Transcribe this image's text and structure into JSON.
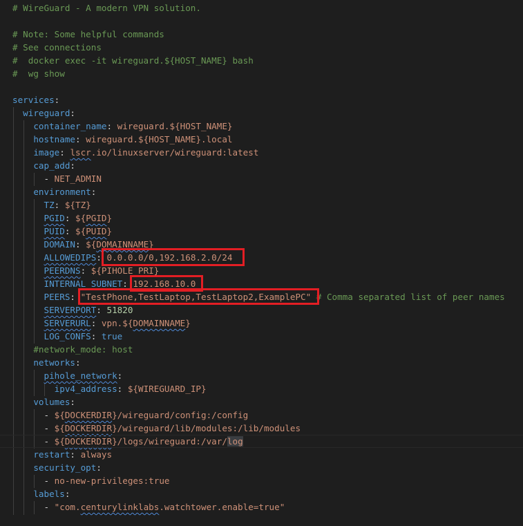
{
  "editor": {
    "language": "yaml",
    "highlight_color": "#e31e24",
    "lines": [
      {
        "tokens": [
          [
            "cm",
            "# WireGuard - A modern VPN solution."
          ]
        ]
      },
      {
        "tokens": []
      },
      {
        "tokens": [
          [
            "cm",
            "# Note: Some helpful commands"
          ]
        ]
      },
      {
        "tokens": [
          [
            "cm",
            "# See connections"
          ]
        ]
      },
      {
        "tokens": [
          [
            "cm",
            "#  docker exec -it wireguard.${HOST_NAME} bash"
          ]
        ]
      },
      {
        "tokens": [
          [
            "cm",
            "#  wg show"
          ]
        ]
      },
      {
        "tokens": []
      },
      {
        "tokens": [
          [
            "k",
            "services"
          ],
          [
            "p",
            ":"
          ]
        ]
      },
      {
        "tokens": [
          [
            "p",
            "  "
          ],
          [
            "k",
            "wireguard"
          ],
          [
            "p",
            ":"
          ]
        ]
      },
      {
        "tokens": [
          [
            "p",
            "    "
          ],
          [
            "k",
            "container_name"
          ],
          [
            "p",
            ": "
          ],
          [
            "s",
            "wireguard.${HOST_NAME}"
          ]
        ]
      },
      {
        "tokens": [
          [
            "p",
            "    "
          ],
          [
            "k",
            "hostname"
          ],
          [
            "p",
            ": "
          ],
          [
            "s",
            "wireguard.${HOST_NAME}.local"
          ]
        ]
      },
      {
        "tokens": [
          [
            "p",
            "    "
          ],
          [
            "k",
            "image"
          ],
          [
            "p",
            ": "
          ],
          [
            "s sq",
            "lscr"
          ],
          [
            "s",
            ".io/linuxserver/wireguard:latest"
          ]
        ]
      },
      {
        "tokens": [
          [
            "p",
            "    "
          ],
          [
            "k",
            "cap_add"
          ],
          [
            "p",
            ":"
          ]
        ]
      },
      {
        "tokens": [
          [
            "p",
            "      - "
          ],
          [
            "s",
            "NET_ADMIN"
          ]
        ]
      },
      {
        "tokens": [
          [
            "p",
            "    "
          ],
          [
            "k",
            "environment"
          ],
          [
            "p",
            ":"
          ]
        ]
      },
      {
        "tokens": [
          [
            "p",
            "      "
          ],
          [
            "k",
            "TZ"
          ],
          [
            "p",
            ": "
          ],
          [
            "s",
            "${TZ}"
          ]
        ]
      },
      {
        "tokens": [
          [
            "p",
            "      "
          ],
          [
            "k sq",
            "PGID"
          ],
          [
            "p",
            ": "
          ],
          [
            "s",
            "${"
          ],
          [
            "s sq",
            "PGID"
          ],
          [
            "s",
            "}"
          ]
        ]
      },
      {
        "tokens": [
          [
            "p",
            "      "
          ],
          [
            "k sq",
            "PUID"
          ],
          [
            "p",
            ": "
          ],
          [
            "s",
            "${"
          ],
          [
            "s sq",
            "PUID"
          ],
          [
            "s",
            "}"
          ]
        ]
      },
      {
        "tokens": [
          [
            "p",
            "      "
          ],
          [
            "k",
            "DOMAIN"
          ],
          [
            "p",
            ": "
          ],
          [
            "s",
            "${"
          ],
          [
            "s sq",
            "DOMAINNAME"
          ],
          [
            "s",
            "}"
          ]
        ]
      },
      {
        "tokens": [
          [
            "p",
            "      "
          ],
          [
            "k sq",
            "ALLOWEDIPS"
          ],
          [
            "p",
            ": "
          ],
          [
            "s",
            "0.0.0.0/0,192.168.2.0/24"
          ]
        ]
      },
      {
        "tokens": [
          [
            "p",
            "      "
          ],
          [
            "k sq",
            "PEERDNS"
          ],
          [
            "p",
            ": "
          ],
          [
            "s",
            "${PIHOLE_PRI}"
          ]
        ]
      },
      {
        "tokens": [
          [
            "p",
            "      "
          ],
          [
            "k",
            "INTERNAL_SUBNET"
          ],
          [
            "p",
            ": "
          ],
          [
            "s",
            "192.168.10.0"
          ]
        ]
      },
      {
        "tokens": [
          [
            "p",
            "      "
          ],
          [
            "k",
            "PEERS"
          ],
          [
            "p",
            ": "
          ],
          [
            "s",
            "\"TestPhone,TestLaptop,TestLaptop2,ExamplePC\""
          ],
          [
            "cm",
            " # Comma separated list of peer names"
          ]
        ]
      },
      {
        "tokens": [
          [
            "p",
            "      "
          ],
          [
            "k sq",
            "SERVERPORT"
          ],
          [
            "p",
            ": "
          ],
          [
            "n",
            "51820"
          ]
        ]
      },
      {
        "tokens": [
          [
            "p",
            "      "
          ],
          [
            "k sq",
            "SERVERURL"
          ],
          [
            "p",
            ": "
          ],
          [
            "s",
            "vpn.${"
          ],
          [
            "s sq",
            "DOMAINNAME"
          ],
          [
            "s",
            "}"
          ]
        ]
      },
      {
        "tokens": [
          [
            "p",
            "      "
          ],
          [
            "k",
            "LOG_CONFS"
          ],
          [
            "p",
            ": "
          ],
          [
            "k",
            "true"
          ]
        ]
      },
      {
        "tokens": [
          [
            "p",
            "    "
          ],
          [
            "cm",
            "#network_mode: host"
          ]
        ]
      },
      {
        "tokens": [
          [
            "p",
            "    "
          ],
          [
            "k",
            "networks"
          ],
          [
            "p",
            ":"
          ]
        ]
      },
      {
        "tokens": [
          [
            "p",
            "      "
          ],
          [
            "k sq",
            "pihole_network"
          ],
          [
            "p",
            ":"
          ]
        ]
      },
      {
        "tokens": [
          [
            "p",
            "        "
          ],
          [
            "k",
            "ipv4_address"
          ],
          [
            "p",
            ": "
          ],
          [
            "s",
            "${WIREGUARD_IP}"
          ]
        ]
      },
      {
        "tokens": [
          [
            "p",
            "    "
          ],
          [
            "k",
            "volumes"
          ],
          [
            "p",
            ":"
          ]
        ]
      },
      {
        "tokens": [
          [
            "p",
            "      - "
          ],
          [
            "s",
            "${"
          ],
          [
            "s sq",
            "DOCKERDIR"
          ],
          [
            "s",
            "}/wireguard/config:/config"
          ]
        ]
      },
      {
        "tokens": [
          [
            "p",
            "      - "
          ],
          [
            "s",
            "${"
          ],
          [
            "s sq",
            "DOCKERDIR"
          ],
          [
            "s",
            "}/wireguard/lib/modules:/lib/modules"
          ]
        ]
      },
      {
        "tokens": [
          [
            "p",
            "      - "
          ],
          [
            "s",
            "${"
          ],
          [
            "s sq",
            "DOCKERDIR"
          ],
          [
            "s",
            "}/logs/wireguard:/var/"
          ],
          [
            "s cursel",
            "log"
          ]
        ]
      },
      {
        "tokens": [
          [
            "p",
            "    "
          ],
          [
            "k",
            "restart"
          ],
          [
            "p",
            ": "
          ],
          [
            "s",
            "always"
          ]
        ]
      },
      {
        "tokens": [
          [
            "p",
            "    "
          ],
          [
            "k",
            "security_opt"
          ],
          [
            "p",
            ":"
          ]
        ]
      },
      {
        "tokens": [
          [
            "p",
            "      - "
          ],
          [
            "s",
            "no-new-privileges:true"
          ]
        ]
      },
      {
        "tokens": [
          [
            "p",
            "    "
          ],
          [
            "k",
            "labels"
          ],
          [
            "p",
            ":"
          ]
        ]
      },
      {
        "tokens": [
          [
            "p",
            "      - "
          ],
          [
            "s",
            "\"com."
          ],
          [
            "s sq",
            "centurylinklabs"
          ],
          [
            "s",
            ".watchtower.enable=true\""
          ]
        ]
      }
    ]
  }
}
